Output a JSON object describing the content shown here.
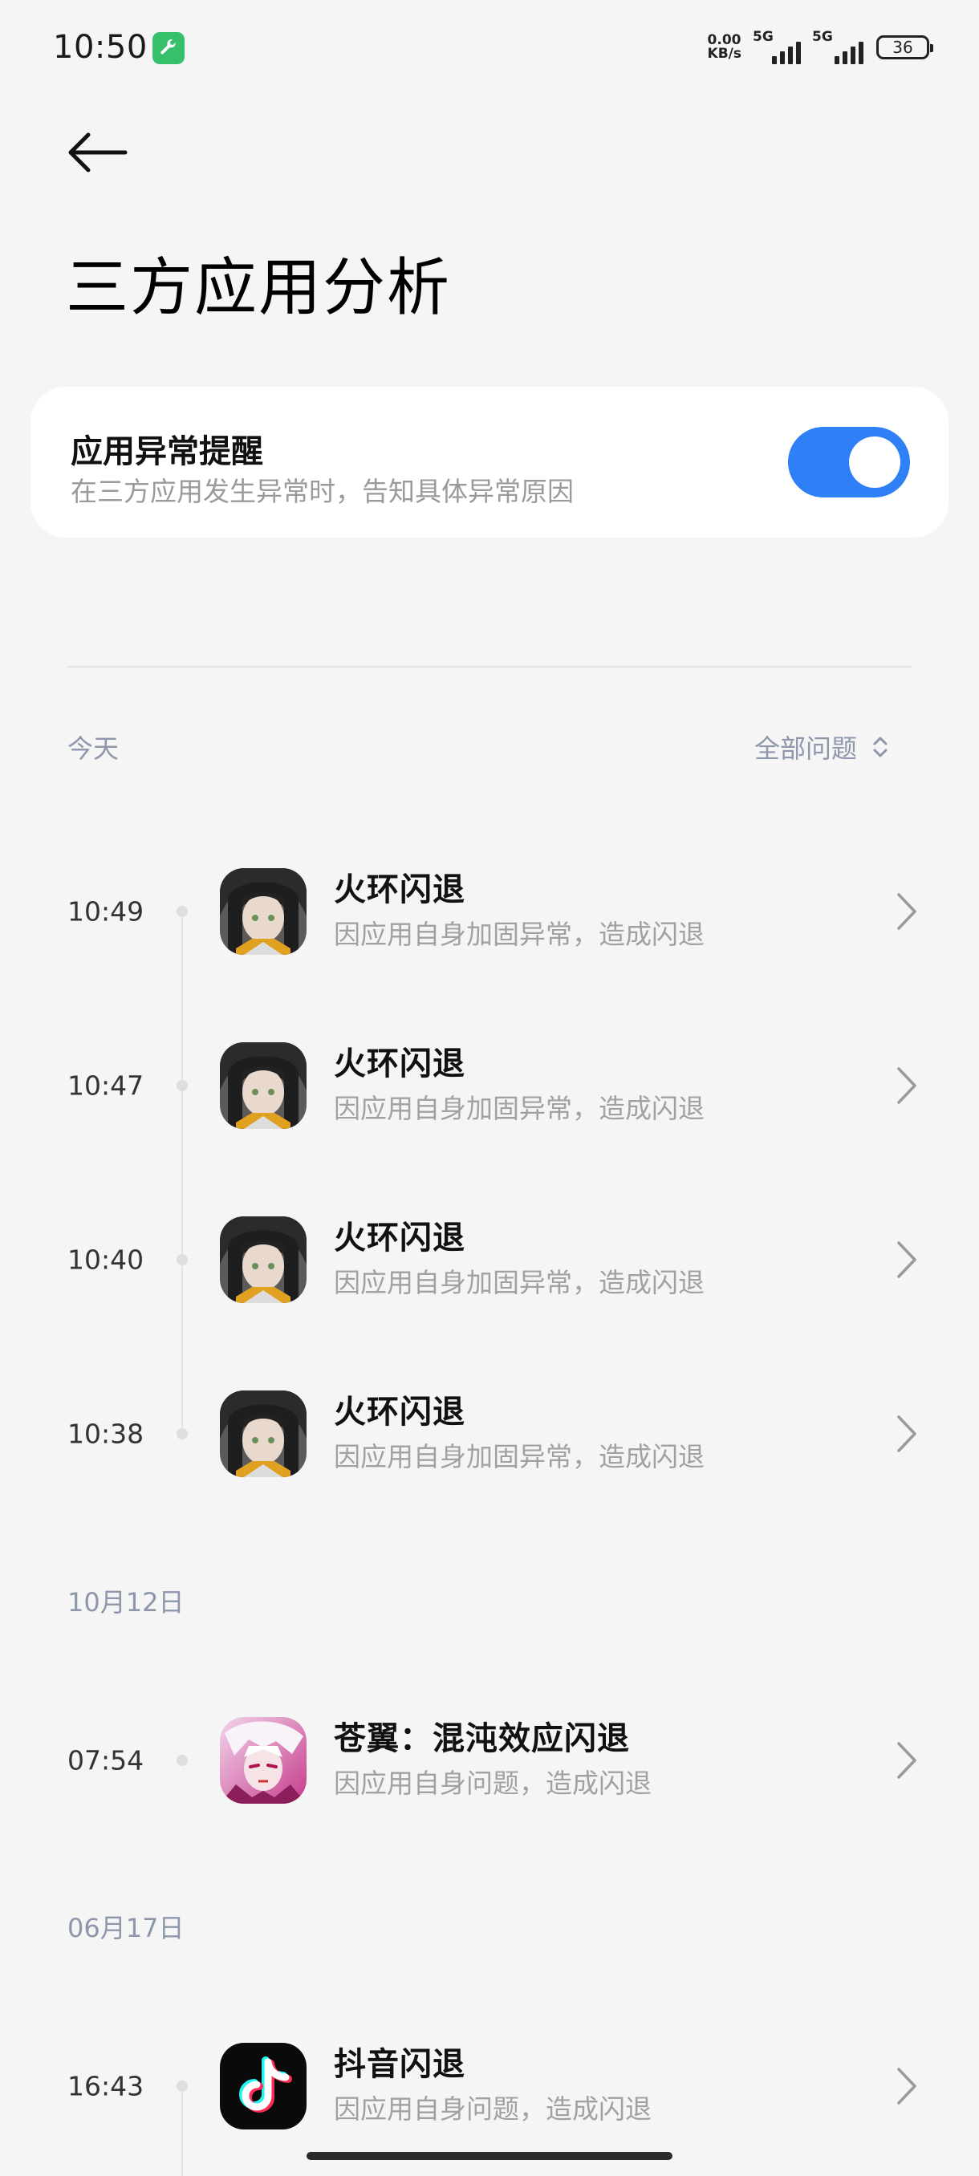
{
  "status_bar": {
    "time": "10:50",
    "net_speed_value": "0.00",
    "net_speed_unit": "KB/s",
    "sim1": "5G",
    "sim2": "5G",
    "battery": "36"
  },
  "header": {
    "title": "三方应用分析"
  },
  "alert_card": {
    "title": "应用异常提醒",
    "subtitle": "在三方应用发生异常时，告知具体异常原因",
    "enabled": true
  },
  "filter_label": "全部问题",
  "groups": [
    {
      "date": "今天",
      "items": [
        {
          "time": "10:49",
          "app_icon": "anime-girl-app-icon",
          "title": "火环闪退",
          "desc": "因应用自身加固异常，造成闪退"
        },
        {
          "time": "10:47",
          "app_icon": "anime-girl-app-icon",
          "title": "火环闪退",
          "desc": "因应用自身加固异常，造成闪退"
        },
        {
          "time": "10:40",
          "app_icon": "anime-girl-app-icon",
          "title": "火环闪退",
          "desc": "因应用自身加固异常，造成闪退"
        },
        {
          "time": "10:38",
          "app_icon": "anime-girl-app-icon",
          "title": "火环闪退",
          "desc": "因应用自身加固异常，造成闪退"
        }
      ]
    },
    {
      "date": "10月12日",
      "items": [
        {
          "time": "07:54",
          "app_icon": "anime-white-hair-app-icon",
          "title": "苍翼：混沌效应闪退",
          "desc": "因应用自身问题，造成闪退"
        }
      ]
    },
    {
      "date": "06月17日",
      "items": [
        {
          "time": "16:43",
          "app_icon": "tiktok-app-icon",
          "title": "抖音闪退",
          "desc": "因应用自身问题，造成闪退"
        }
      ]
    }
  ],
  "colors": {
    "accent": "#2f80f6",
    "background": "#f5f5f5",
    "section_label": "#8d96ab"
  }
}
